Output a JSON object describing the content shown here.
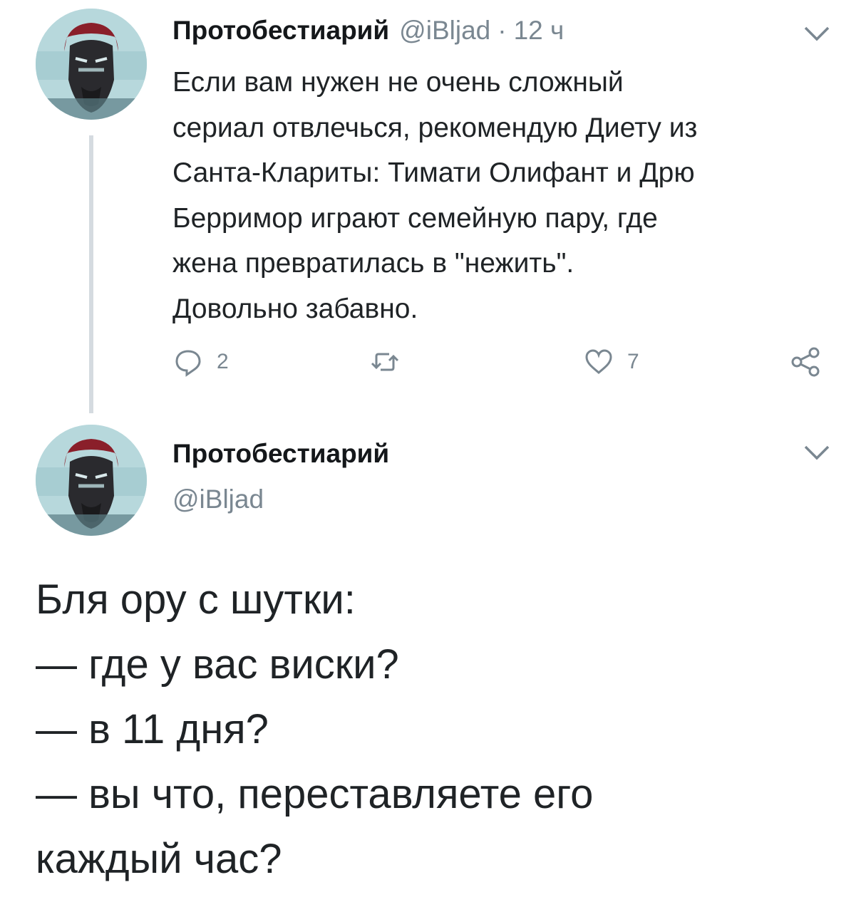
{
  "reply_tweet": {
    "author_name": "Протобестиарий",
    "handle": "@iBljad",
    "separator": "·",
    "time": "12 ч",
    "text_lines": [
      "Если вам нужен не очень сложный",
      "сериал отвлечься, рекомендую Диету из",
      "Санта-Клариты: Тимати Олифант и Дрю",
      "Берримор играют семейную пару, где",
      "жена превратилась в \"нежить\".",
      "Довольно забавно."
    ],
    "actions": {
      "reply_count": "2",
      "retweet_count": "",
      "like_count": "7"
    },
    "icons": {
      "reply": "reply-icon",
      "retweet": "retweet-icon",
      "like": "heart-icon",
      "share": "share-icon",
      "menu": "chevron-down-icon"
    }
  },
  "main_tweet": {
    "author_name": "Протобестиарий",
    "handle": "@iBljad",
    "text_lines": [
      "Бля ору с шутки:",
      "— где у вас виски?",
      "— в 11 дня?",
      "— вы что, переставляете его",
      "каждый час?"
    ]
  },
  "colors": {
    "text": "#1f2326",
    "muted": "#7a8791",
    "thread_line": "#d5dbe0",
    "avatar_bg": "#b7d8dc",
    "avatar_accent": "#8a1f2a"
  }
}
